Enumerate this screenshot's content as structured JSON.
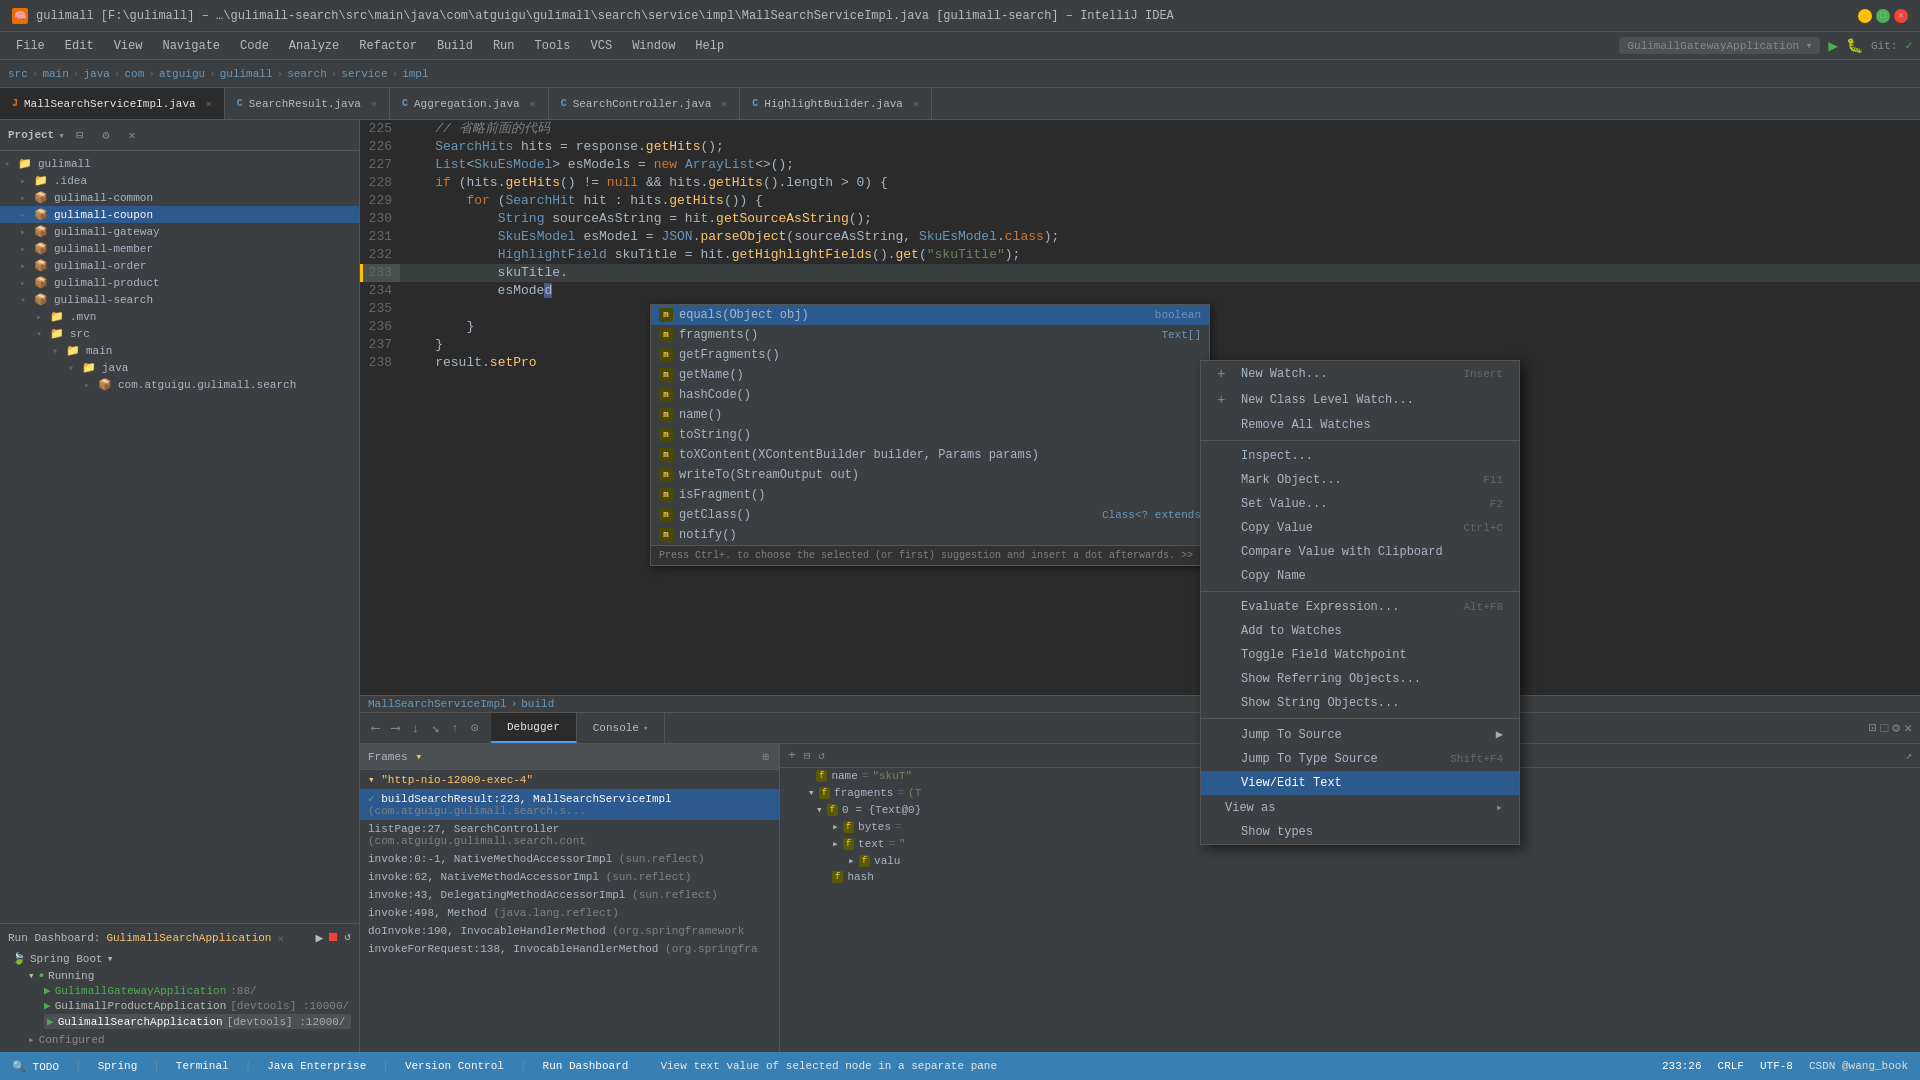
{
  "titlebar": {
    "title": "gulimall [F:\\gulimall] – …\\gulimall-search\\src\\main\\java\\com\\atguigu\\gulimall\\search\\service\\impl\\MallSearchServiceImpl.java [gulimall-search] – IntelliJ IDEA",
    "app": "IntelliJ IDEA"
  },
  "menubar": {
    "items": [
      "File",
      "Edit",
      "View",
      "Navigate",
      "Code",
      "Analyze",
      "Refactor",
      "Build",
      "Run",
      "Tools",
      "VCS",
      "Window",
      "Help"
    ]
  },
  "breadcrumb": {
    "items": [
      "src",
      "main",
      "java",
      "com",
      "atguigu",
      "gulimall",
      "search",
      "service",
      "impl"
    ]
  },
  "tabs": [
    {
      "label": "MallSearchServiceImpl.java",
      "active": true,
      "type": "java"
    },
    {
      "label": "SearchResult.java",
      "active": false,
      "type": "java"
    },
    {
      "label": "Aggregation.java",
      "active": false,
      "type": "java"
    },
    {
      "label": "SearchController.java",
      "active": false,
      "type": "java"
    },
    {
      "label": "HighlightBuilder.java",
      "active": false,
      "type": "java"
    }
  ],
  "editor": {
    "lines": [
      {
        "num": 225,
        "content": "    // 省略前面的代码"
      },
      {
        "num": 226,
        "content": "    SearchHits hits = response.getHits();"
      },
      {
        "num": 227,
        "content": "    List<SkuEsModel> esModels = new ArrayList<>();"
      },
      {
        "num": 228,
        "content": "    if (hits.getHits() != null && hits.getHits().length > 0) {"
      },
      {
        "num": 229,
        "content": "        for (SearchHit hit : hits.getHits()) {"
      },
      {
        "num": 230,
        "content": "            String sourceAsString = hit.getSourceAsString();"
      },
      {
        "num": 231,
        "content": "            SkuEsModel esModel = JSON.parseObject(sourceAsString, SkuEsModel.class);"
      },
      {
        "num": 232,
        "content": "            HighlightField skuTitle = hit.getHighlightFields().get(\"skuTitle\");"
      },
      {
        "num": 233,
        "content": "            skuTitle.",
        "highlighted": true
      },
      {
        "num": 234,
        "content": "            esMode"
      },
      {
        "num": 235,
        "content": ""
      },
      {
        "num": 236,
        "content": "        }"
      },
      {
        "num": 237,
        "content": "    }"
      },
      {
        "num": 238,
        "content": "    result.setPro"
      }
    ]
  },
  "autocomplete": {
    "items": [
      {
        "icon": "m",
        "label": "equals(Object obj)",
        "type": "boolean"
      },
      {
        "icon": "m",
        "label": "fragments()",
        "type": "Text[]"
      },
      {
        "icon": "m",
        "label": "getFragments()",
        "type": ""
      },
      {
        "icon": "m",
        "label": "getName()",
        "type": ""
      },
      {
        "icon": "m",
        "label": "hashCode()",
        "type": ""
      },
      {
        "icon": "m",
        "label": "name()",
        "type": ""
      },
      {
        "icon": "m",
        "label": "toString()",
        "type": ""
      },
      {
        "icon": "m",
        "label": "toXContent(XContentBuilder builder, Params params)",
        "type": ""
      },
      {
        "icon": "m",
        "label": "writeTo(StreamOutput out)",
        "type": ""
      },
      {
        "icon": "m",
        "label": "isFragment()",
        "type": ""
      },
      {
        "icon": "m",
        "label": "getClass()",
        "type": ""
      },
      {
        "icon": "m",
        "label": "notify()",
        "type": ""
      }
    ],
    "hint": "Press Ctrl+. to choose the selected (or first) suggestion and insert a dot afterwards. >>",
    "selected": 1
  },
  "sidebar": {
    "title": "Project",
    "items": [
      {
        "label": "gulimall",
        "level": 0,
        "expanded": true,
        "type": "root"
      },
      {
        "label": ".idea",
        "level": 1,
        "expanded": false,
        "type": "folder"
      },
      {
        "label": "gulimall-common",
        "level": 1,
        "expanded": false,
        "type": "module"
      },
      {
        "label": "gulimall-coupon",
        "level": 1,
        "expanded": false,
        "type": "module",
        "active": true
      },
      {
        "label": "gulimall-gateway",
        "level": 1,
        "expanded": false,
        "type": "module"
      },
      {
        "label": "gulimall-member",
        "level": 1,
        "expanded": false,
        "type": "module"
      },
      {
        "label": "gulimall-order",
        "level": 1,
        "expanded": false,
        "type": "module"
      },
      {
        "label": "gulimall-product",
        "level": 1,
        "expanded": false,
        "type": "module"
      },
      {
        "label": "gulimall-search",
        "level": 1,
        "expanded": true,
        "type": "module"
      },
      {
        "label": ".mvn",
        "level": 2,
        "expanded": false,
        "type": "folder"
      },
      {
        "label": "src",
        "level": 2,
        "expanded": true,
        "type": "folder"
      },
      {
        "label": "main",
        "level": 3,
        "expanded": true,
        "type": "folder"
      },
      {
        "label": "java",
        "level": 4,
        "expanded": true,
        "type": "folder"
      },
      {
        "label": "com.atguigu.gulimall.search",
        "level": 5,
        "expanded": false,
        "type": "package"
      }
    ]
  },
  "run_dashboard": {
    "label": "Run Dashboard:",
    "app": "GulimallSearchApplication",
    "spring_boot_label": "Spring Boot",
    "running_label": "Running",
    "apps": [
      {
        "name": "GulimallGatewayApplication",
        "port": "88",
        "status": "running"
      },
      {
        "name": "GulimallProductApplication",
        "port": "10000",
        "type": "devtools"
      },
      {
        "name": "GulimallSearchApplication",
        "port": "12000",
        "type": "devtools",
        "active": true
      }
    ],
    "configured_label": "Configured"
  },
  "bottom_panel": {
    "tabs": [
      "Debugger",
      "Console"
    ],
    "active_tab": "Debugger",
    "frames_tab": "Frames",
    "frames": [
      {
        "method": "\"http-nio-12000-exec-4\"",
        "active": true
      },
      {
        "method": "buildSearchResult:223, MallSearchServiceImpl",
        "loc": "(com.atguigu.gulimall.search.s...",
        "active": true
      },
      {
        "method": "listPage:27, SearchController",
        "loc": "(com.atguigu.gulimall.search.cont"
      },
      {
        "method": "invoke:0:-1, NativeMethodAccessorImpl",
        "loc": "(sun.reflect)"
      },
      {
        "method": "invoke:62, NativeMethodAccessorImpl",
        "loc": "(sun.reflect)"
      },
      {
        "method": "invoke:43, DelegatingMethodAccessorImpl",
        "loc": "(sun.reflect)"
      },
      {
        "method": "invoke:498, Method",
        "loc": "(java.lang.reflect)"
      },
      {
        "method": "doInvoke:190, InvocableHandlerMethod",
        "loc": "(org.springframework"
      },
      {
        "method": "invokeForRequest:138, InvocableHandlerMethod",
        "loc": "(org.springfra"
      }
    ],
    "variables": [
      {
        "name": "f name",
        "eq": "=",
        "val": "\"skuT\"",
        "indent": 2,
        "icon": "f"
      },
      {
        "name": "fragments",
        "eq": "=",
        "val": "(T",
        "indent": 2,
        "icon": "f"
      },
      {
        "name": "0 = {Text@0}",
        "indent": 3,
        "icon": "f"
      },
      {
        "name": "bytes",
        "eq": "=",
        "indent": 4,
        "icon": "f"
      },
      {
        "name": "f text",
        "eq": "=",
        "val": "\"",
        "indent": 4,
        "icon": "f"
      },
      {
        "name": "f valu",
        "indent": 5,
        "icon": "f"
      },
      {
        "name": "hash",
        "indent": 4,
        "icon": "f"
      }
    ]
  },
  "context_menu": {
    "items": [
      {
        "label": "New Watch...",
        "key": "Insert",
        "type": "new"
      },
      {
        "label": "New Class Level Watch...",
        "type": "new"
      },
      {
        "label": "Remove All Watches",
        "type": "action"
      },
      {
        "separator": true
      },
      {
        "label": "Inspect...",
        "type": "action"
      },
      {
        "label": "Mark Object...",
        "key": "",
        "type": "action"
      },
      {
        "label": "Set Value...",
        "key": "F2",
        "type": "action"
      },
      {
        "label": "Copy Value",
        "key": "Ctrl+C",
        "type": "action"
      },
      {
        "label": "Compare Value with Clipboard",
        "type": "action"
      },
      {
        "label": "Copy Name",
        "type": "action"
      },
      {
        "separator": true
      },
      {
        "label": "Evaluate Expression...",
        "key": "Alt+F8",
        "type": "action"
      },
      {
        "label": "Add to Watches",
        "type": "action"
      },
      {
        "label": "Toggle Field Watchpoint",
        "type": "action"
      },
      {
        "label": "Show Referring Objects...",
        "type": "action"
      },
      {
        "label": "Show String Objects...",
        "type": "action"
      },
      {
        "separator": true
      },
      {
        "label": "Jump To Source",
        "key": "",
        "type": "action"
      },
      {
        "label": "Jump To Type Source",
        "key": "Shift+F4",
        "type": "action"
      },
      {
        "label": "View/Edit Text",
        "key": "",
        "type": "action",
        "highlighted": true
      },
      {
        "label": "View as",
        "type": "submenu"
      },
      {
        "label": "Show types",
        "type": "action"
      }
    ]
  },
  "statusbar": {
    "left": "🔍 TODO | Spring | Terminal | Java Enterprise | Version Control | Run Dashboard",
    "text": "View text value of selected node in a separate pane",
    "position": "233:26",
    "encoding": "CRLF",
    "charset": "UTF-8",
    "right": "CSDN @wang_book"
  }
}
